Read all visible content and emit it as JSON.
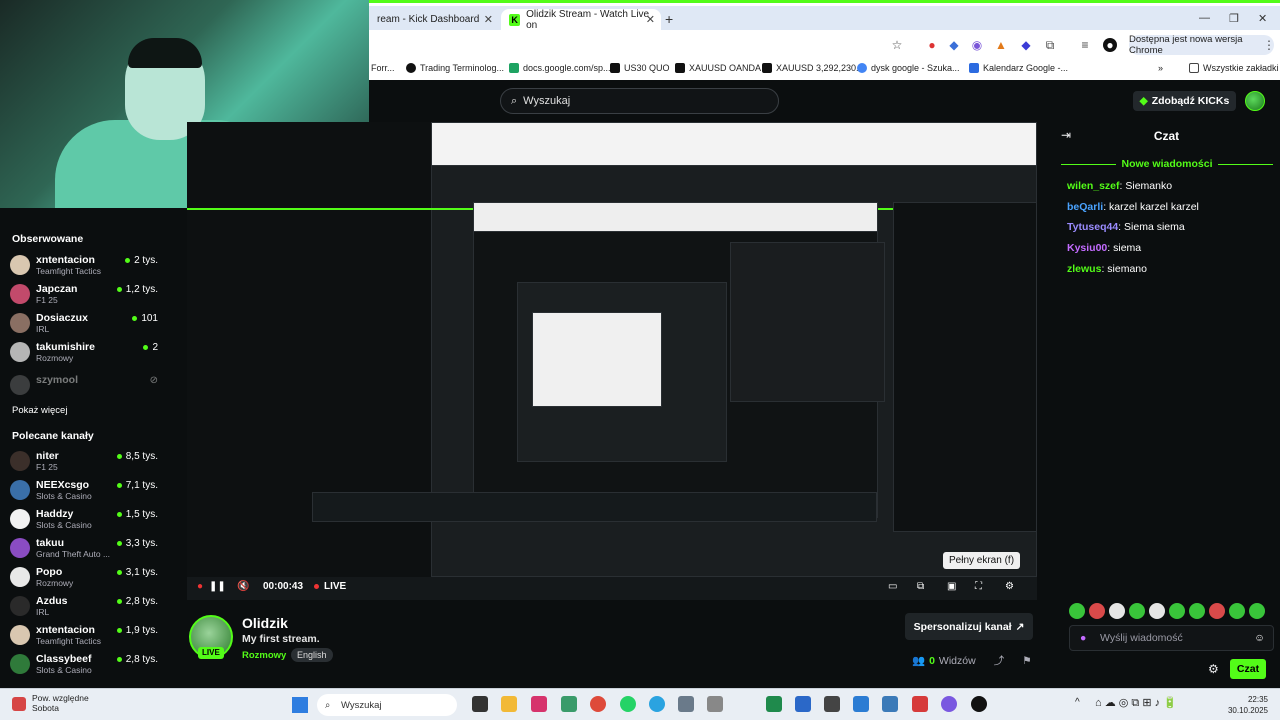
{
  "chrome": {
    "tab_inactive": "ream - Kick Dashboard",
    "tab_active": "Olidzik Stream - Watch Live on",
    "update_label": "Dostępna jest nowa wersja Chrome",
    "bookmarks": [
      "Forr...",
      "Trading Terminolog...",
      "docs.google.com/sp...",
      "US30 QUO",
      "XAUUSD OANDA",
      "XAUUSD 3,292,230...",
      "dysk google - Szuka...",
      "Kalendarz Google -...",
      "Wszystkie zakładki"
    ]
  },
  "header": {
    "search_label": "Wyszukaj",
    "get_kicks_label": "Zdobądź KICKs"
  },
  "sidebar": {
    "followed_title": "Obserwowane",
    "followed": [
      {
        "name": "xntentacion",
        "category": "Teamfight Tactics",
        "viewers": "2 tys."
      },
      {
        "name": "Japczan",
        "category": "F1 25",
        "viewers": "1,2 tys."
      },
      {
        "name": "Dosiaczux",
        "category": "IRL",
        "viewers": "101"
      },
      {
        "name": "takumishire",
        "category": "Rozmowy",
        "viewers": "2"
      },
      {
        "name": "szymool",
        "category": "",
        "viewers": ""
      }
    ],
    "show_more": "Pokaż więcej",
    "recommended_title": "Polecane kanały",
    "recommended": [
      {
        "name": "niter",
        "category": "F1 25",
        "viewers": "8,5 tys."
      },
      {
        "name": "NEEXcsgo",
        "category": "Slots & Casino",
        "viewers": "7,1 tys."
      },
      {
        "name": "Haddzy",
        "category": "Slots & Casino",
        "viewers": "1,5 tys."
      },
      {
        "name": "takuu",
        "category": "Grand Theft Auto ...",
        "viewers": "3,3 tys."
      },
      {
        "name": "Popo",
        "category": "Rozmowy",
        "viewers": "3,1 tys."
      },
      {
        "name": "Azdus",
        "category": "IRL",
        "viewers": "2,8 tys."
      },
      {
        "name": "xntentacion",
        "category": "Teamfight Tactics",
        "viewers": "1,9 tys."
      },
      {
        "name": "Classybeef",
        "category": "Slots & Casino",
        "viewers": "2,8 tys."
      }
    ]
  },
  "player": {
    "time": "00:00:43",
    "live_label": "LIVE",
    "fullscreen_tooltip": "Pełny ekran (f)"
  },
  "stream": {
    "streamer": "Olidzik",
    "title": "My first stream.",
    "category": "Rozmowy",
    "language": "English",
    "live_badge": "LIVE",
    "personalize_label": "Spersonalizuj kanał",
    "viewers_count": "0",
    "viewers_label": "Widzów"
  },
  "chat": {
    "title": "Czat",
    "new_messages": "Nowe wiadomości",
    "messages": [
      {
        "user": "wilen_szef",
        "text": "Siemanko",
        "color": "#53fc18"
      },
      {
        "user": "beQarli",
        "text": "karzel karzel karzel",
        "color": "#4aa3ff"
      },
      {
        "user": "Tytuseq44",
        "text": "Siema siema",
        "color": "#9b8cff"
      },
      {
        "user": "Kysiu00",
        "text": "siema",
        "color": "#c36bff"
      },
      {
        "user": "zlewus",
        "text": "siemano",
        "color": "#53fc18"
      }
    ],
    "input_placeholder": "Wyślij wiadomość",
    "send_label": "Czat"
  },
  "taskbar": {
    "weather_line1": "Pow. względne",
    "weather_line2": "Sobota",
    "search_label": "Wyszukaj",
    "time": "22:35",
    "date": "30.10.2025"
  },
  "colors": {
    "accent": "#53fc18",
    "background": "#0b0e0f"
  }
}
